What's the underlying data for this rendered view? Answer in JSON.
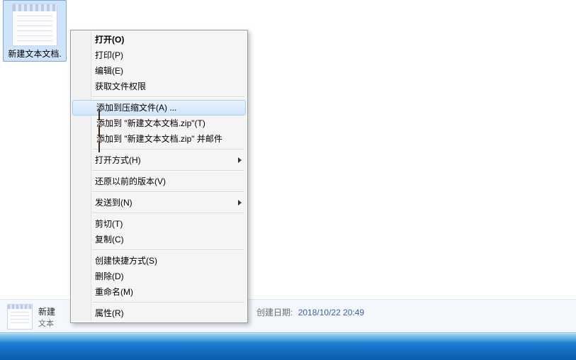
{
  "file": {
    "label": "新建文本文档."
  },
  "details": {
    "name_short": "新建",
    "type_line": "文本",
    "date_key": "创建日期:",
    "date_val": "2018/10/22 20:49"
  },
  "context_menu": {
    "sections": [
      [
        {
          "id": "open",
          "label": "打开(O)",
          "bold": true
        },
        {
          "id": "print",
          "label": "打印(P)"
        },
        {
          "id": "edit",
          "label": "编辑(E)"
        },
        {
          "id": "get-perm",
          "label": "获取文件权限"
        }
      ],
      [
        {
          "id": "add-archive",
          "label": "添加到压缩文件(A) ...",
          "icon": "rar",
          "highlight": true
        },
        {
          "id": "add-zip",
          "label": "添加到 \"新建文本文档.zip\"(T)",
          "icon": "rar"
        },
        {
          "id": "add-zip-mail",
          "label": "添加到 \"新建文本文档.zip\" 并邮件",
          "icon": "rar"
        }
      ],
      [
        {
          "id": "open-with",
          "label": "打开方式(H)",
          "submenu": true
        }
      ],
      [
        {
          "id": "restore-ver",
          "label": "还原以前的版本(V)"
        }
      ],
      [
        {
          "id": "send-to",
          "label": "发送到(N)",
          "submenu": true
        }
      ],
      [
        {
          "id": "cut",
          "label": "剪切(T)"
        },
        {
          "id": "copy",
          "label": "复制(C)"
        }
      ],
      [
        {
          "id": "shortcut",
          "label": "创建快捷方式(S)"
        },
        {
          "id": "delete",
          "label": "删除(D)"
        },
        {
          "id": "rename",
          "label": "重命名(M)"
        }
      ],
      [
        {
          "id": "properties",
          "label": "属性(R)"
        }
      ]
    ]
  }
}
